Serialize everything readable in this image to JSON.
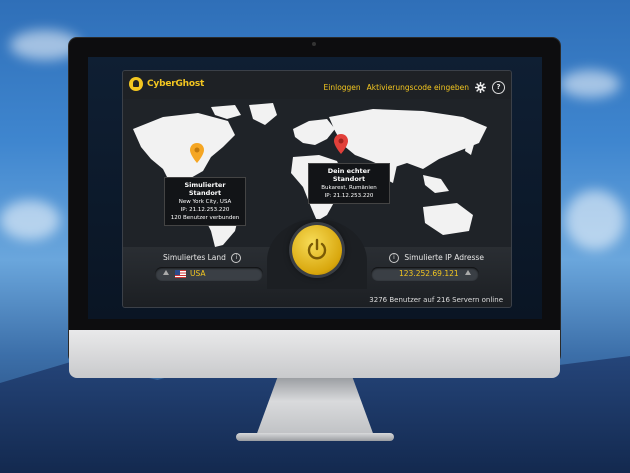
{
  "app": {
    "brand": "CyberGhost",
    "login_link": "Einloggen",
    "activation_link": "Aktivierungscode eingeben",
    "help_label": "?"
  },
  "simulated_location": {
    "title": "Simulierter Standort",
    "city": "New York City, USA",
    "ip": "IP: 21.12.253.220",
    "users": "120 Benutzer verbunden"
  },
  "real_location": {
    "title": "Dein echter Standort",
    "city": "Bukarest, Rumänien",
    "ip": "IP: 21.12.253.220"
  },
  "controls": {
    "country_label": "Simuliertes Land",
    "country_value": "USA",
    "ip_label": "Simulierte IP Adresse",
    "ip_value": "123.252.69.121",
    "info_glyph": "i"
  },
  "status_text": "3276 Benutzer auf 216 Servern online",
  "colors": {
    "accent": "#f3c620",
    "map_land": "#f2f2f2",
    "pin_simulated": "#f5a623",
    "pin_real": "#e2403a"
  }
}
